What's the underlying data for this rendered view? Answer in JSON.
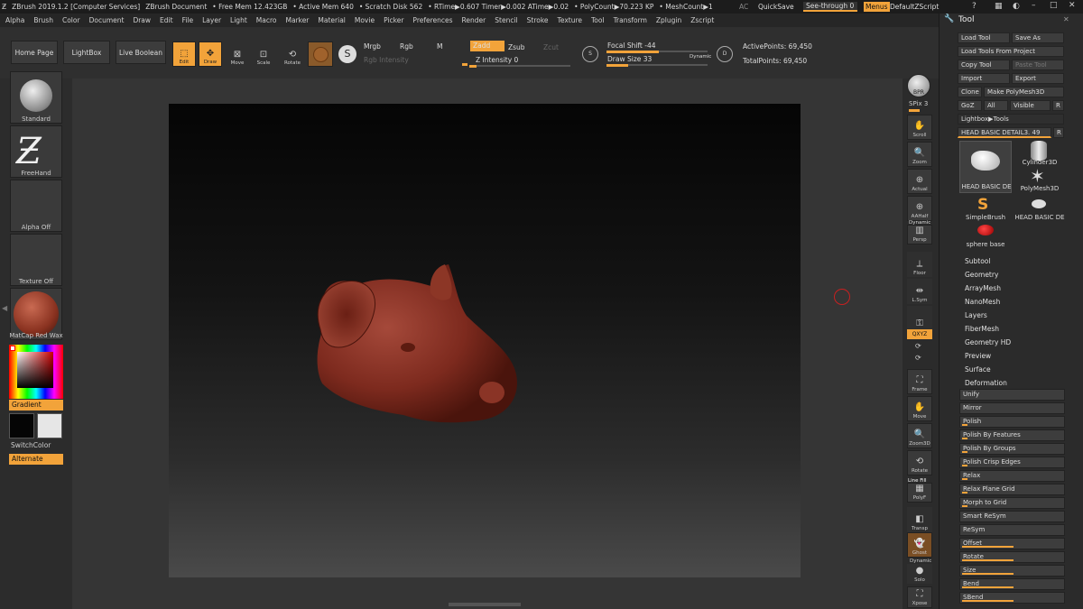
{
  "titlebar": {
    "app": "ZBrush 2019.1.2 [Computer Services]",
    "doc": "ZBrush Document",
    "free_mem": "• Free Mem 12.423GB",
    "active_mem": "• Active Mem 640",
    "scratch": "• Scratch Disk 562",
    "rtime": "• RTime▶0.607 Timer▶0.002 ATime▶0.02",
    "poly": "• PolyCount▶70.223 KP",
    "mesh": "• MeshCount▶1",
    "ac": "AC",
    "quicksave": "QuickSave",
    "seethrough": "See-through  0",
    "menus": "Menus",
    "script": "DefaultZScript"
  },
  "menubar": [
    "Alpha",
    "Brush",
    "Color",
    "Document",
    "Draw",
    "Edit",
    "File",
    "Layer",
    "Light",
    "Macro",
    "Marker",
    "Material",
    "Movie",
    "Picker",
    "Preferences",
    "Render",
    "Stencil",
    "Stroke",
    "Texture",
    "Tool",
    "Transform",
    "Zplugin",
    "Zscript"
  ],
  "shelf": {
    "home": "Home Page",
    "lightbox": "LightBox",
    "liveboolean": "Live Boolean",
    "edit": "Edit",
    "draw": "Draw",
    "move": "Move",
    "scale": "Scale",
    "rotate": "Rotate",
    "mrgb": "Mrgb",
    "rgb": "Rgb",
    "m": "M",
    "zadd": "Zadd",
    "zsub": "Zsub",
    "zcut": "Zcut",
    "rgb_intensity": "Rgb Intensity",
    "z_intensity": "Z Intensity 0",
    "focal_shift": "Focal Shift -44",
    "draw_size": "Draw Size 33",
    "dynamic": "Dynamic",
    "active_points": "ActivePoints: 69,450",
    "total_points": "TotalPoints: 69,450"
  },
  "leftpanel": {
    "brush": "Standard",
    "stroke": "FreeHand",
    "alpha": "Alpha Off",
    "texture": "Texture Off",
    "material": "MatCap Red Wax",
    "gradient": "Gradient",
    "switchcolor": "SwitchColor",
    "alternate": "Alternate"
  },
  "rightbar": {
    "bpr": "BPR",
    "spix": "SPix 3",
    "scroll": "Scroll",
    "zoom": "Zoom",
    "actual": "Actual",
    "aahalf": "AAHalf",
    "dynamic": "Dynamic",
    "persp": "Persp",
    "floor": "Floor",
    "lsym": "L.Sym",
    "xyz": "QXYZ",
    "frame": "Frame",
    "move": "Move",
    "zoom3d": "Zoom3D",
    "rotate": "Rotate",
    "linefill": "Line Fill",
    "polyf": "PolyF",
    "transp": "Transp",
    "ghost": "Ghost",
    "dynamic2": "Dynamic",
    "solo": "Solo",
    "xpose": "Xpose"
  },
  "toolpanel": {
    "title": "Tool",
    "load_tool": "Load Tool",
    "save_as": "Save As",
    "load_from_project": "Load Tools From Project",
    "copy_tool": "Copy Tool",
    "paste_tool": "Paste Tool",
    "import": "Import",
    "export": "Export",
    "clone": "Clone",
    "make_polymesh": "Make PolyMesh3D",
    "goz": "GoZ",
    "all": "All",
    "visible": "Visible",
    "r": "R",
    "lightbox_tools": "Lightbox▶Tools",
    "current_tool": "HEAD BASIC DETAIL3. 49",
    "tools": [
      "HEAD BASIC DE",
      "Cylinder3D",
      "PolyMesh3D",
      "SimpleBrush",
      "HEAD BASIC DE",
      "sphere base"
    ],
    "subpalettes": [
      "Subtool",
      "Geometry",
      "ArrayMesh",
      "NanoMesh",
      "Layers",
      "FiberMesh",
      "Geometry HD",
      "Preview",
      "Surface",
      "Deformation"
    ],
    "deformation": [
      {
        "label": "Unify",
        "fill": 0
      },
      {
        "label": "Mirror",
        "fill": 0
      },
      {
        "label": "Polish",
        "fill": 0.05
      },
      {
        "label": "Polish By Features",
        "fill": 0.05
      },
      {
        "label": "Polish By Groups",
        "fill": 0.05
      },
      {
        "label": "Polish Crisp Edges",
        "fill": 0.05
      },
      {
        "label": "Relax",
        "fill": 0.05
      },
      {
        "label": "Relax Plane Grid",
        "fill": 0.05
      },
      {
        "label": "Morph to Grid",
        "fill": 0.05
      },
      {
        "label": "Smart ReSym",
        "fill": 0
      },
      {
        "label": "ReSym",
        "fill": 0
      },
      {
        "label": "Offset",
        "fill": 0.5
      },
      {
        "label": "Rotate",
        "fill": 0.5
      },
      {
        "label": "Size",
        "fill": 0.5
      },
      {
        "label": "Bend",
        "fill": 0.5
      },
      {
        "label": "SBend",
        "fill": 0.5
      }
    ]
  }
}
